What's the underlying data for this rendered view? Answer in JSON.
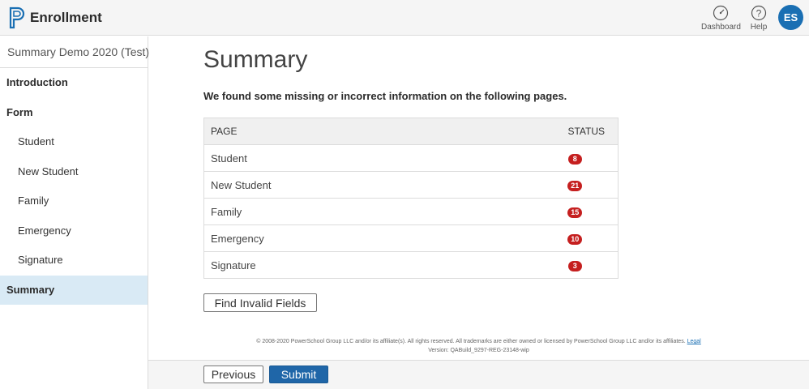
{
  "header": {
    "app_title": "Enrollment",
    "dashboard_label": "Dashboard",
    "help_label": "Help",
    "avatar_initials": "ES",
    "accent_color": "#1a6fb3"
  },
  "sidebar": {
    "title": "Summary Demo 2020 (Test)",
    "items": [
      {
        "label": "Introduction"
      },
      {
        "label": "Form"
      },
      {
        "label": "Student"
      },
      {
        "label": "New Student"
      },
      {
        "label": "Family"
      },
      {
        "label": "Emergency"
      },
      {
        "label": "Signature"
      },
      {
        "label": "Summary"
      }
    ]
  },
  "main": {
    "title": "Summary",
    "message": "We found some missing or incorrect information on the following pages.",
    "table": {
      "headers": {
        "page": "PAGE",
        "status": "STATUS"
      },
      "rows": [
        {
          "page": "Student",
          "count": "8"
        },
        {
          "page": "New Student",
          "count": "21"
        },
        {
          "page": "Family",
          "count": "15"
        },
        {
          "page": "Emergency",
          "count": "10"
        },
        {
          "page": "Signature",
          "count": "3"
        }
      ],
      "badge_color": "#c51f1f"
    },
    "find_button": "Find Invalid Fields"
  },
  "footer": {
    "copyright": "© 2008-2020 PowerSchool Group LLC and/or its affiliate(s). All rights reserved. All trademarks are either owned or licensed by PowerSchool Group LLC and/or its affiliates.",
    "legal_link": "Legal",
    "version": "Version: QABuild_9297-REG-23148-wip"
  },
  "actions": {
    "previous_label": "Previous",
    "submit_label": "Submit"
  }
}
